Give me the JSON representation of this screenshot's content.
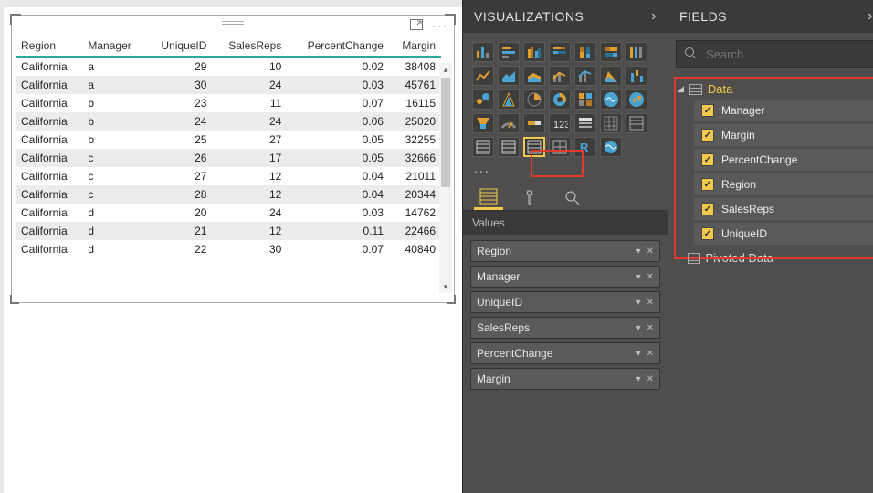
{
  "visualizations": {
    "title": "VISUALIZATIONS"
  },
  "fieldsPanel": {
    "title": "FIELDS"
  },
  "search": {
    "placeholder": "Search"
  },
  "grid": {
    "columns": [
      "Region",
      "Manager",
      "UniqueID",
      "SalesReps",
      "PercentChange",
      "Margin"
    ],
    "rows": [
      {
        "Region": "California",
        "Manager": "a",
        "UniqueID": "29",
        "SalesReps": "10",
        "PercentChange": "0.02",
        "Margin": "38408"
      },
      {
        "Region": "California",
        "Manager": "a",
        "UniqueID": "30",
        "SalesReps": "24",
        "PercentChange": "0.03",
        "Margin": "45761"
      },
      {
        "Region": "California",
        "Manager": "b",
        "UniqueID": "23",
        "SalesReps": "11",
        "PercentChange": "0.07",
        "Margin": "16115"
      },
      {
        "Region": "California",
        "Manager": "b",
        "UniqueID": "24",
        "SalesReps": "24",
        "PercentChange": "0.06",
        "Margin": "25020"
      },
      {
        "Region": "California",
        "Manager": "b",
        "UniqueID": "25",
        "SalesReps": "27",
        "PercentChange": "0.05",
        "Margin": "32255"
      },
      {
        "Region": "California",
        "Manager": "c",
        "UniqueID": "26",
        "SalesReps": "17",
        "PercentChange": "0.05",
        "Margin": "32666"
      },
      {
        "Region": "California",
        "Manager": "c",
        "UniqueID": "27",
        "SalesReps": "12",
        "PercentChange": "0.04",
        "Margin": "21011"
      },
      {
        "Region": "California",
        "Manager": "c",
        "UniqueID": "28",
        "SalesReps": "12",
        "PercentChange": "0.04",
        "Margin": "20344"
      },
      {
        "Region": "California",
        "Manager": "d",
        "UniqueID": "20",
        "SalesReps": "24",
        "PercentChange": "0.03",
        "Margin": "14762"
      },
      {
        "Region": "California",
        "Manager": "d",
        "UniqueID": "21",
        "SalesReps": "12",
        "PercentChange": "0.11",
        "Margin": "22466"
      },
      {
        "Region": "California",
        "Manager": "d",
        "UniqueID": "22",
        "SalesReps": "30",
        "PercentChange": "0.07",
        "Margin": "40840"
      }
    ]
  },
  "values": {
    "title": "Values",
    "items": [
      "Region",
      "Manager",
      "UniqueID",
      "SalesReps",
      "PercentChange",
      "Margin"
    ]
  },
  "fields": {
    "tables": [
      {
        "name": "Data",
        "expanded": true,
        "fields": [
          "Manager",
          "Margin",
          "PercentChange",
          "Region",
          "SalesReps",
          "UniqueID"
        ]
      },
      {
        "name": "Pivoted Data",
        "expanded": false,
        "fields": []
      }
    ]
  }
}
